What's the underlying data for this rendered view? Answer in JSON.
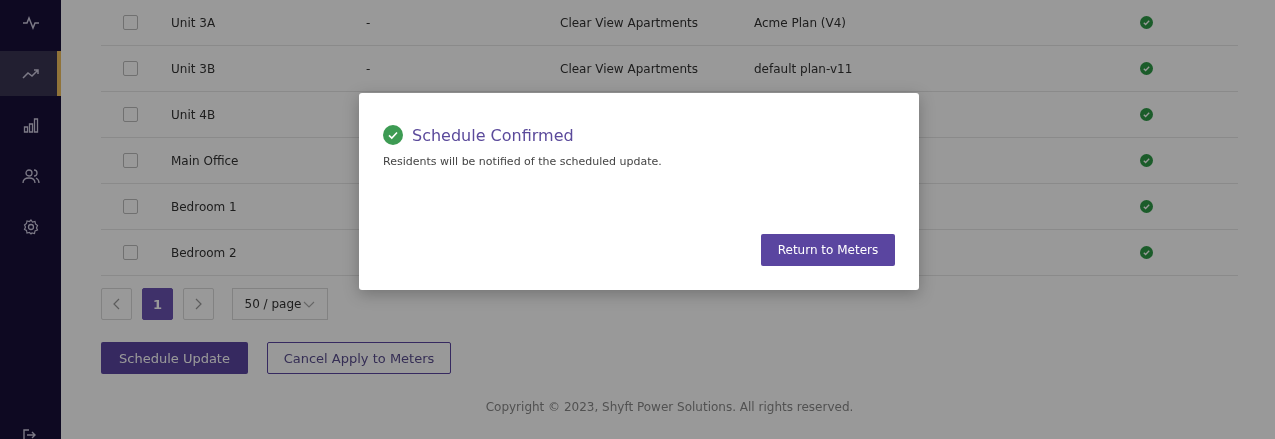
{
  "sidebar": {
    "items": [
      {
        "selected": false
      },
      {
        "selected": true
      },
      {
        "selected": false
      },
      {
        "selected": false
      },
      {
        "selected": false
      }
    ]
  },
  "table": {
    "rows": [
      {
        "checked": false,
        "name": "Unit 3A",
        "column_2": "-",
        "column_3": "Clear View Apartments",
        "column_4": "Acme Plan (V4)"
      },
      {
        "checked": false,
        "name": "Unit 3B",
        "column_2": "-",
        "column_3": "Clear View Apartments",
        "column_4": "default plan-v11"
      },
      {
        "checked": false,
        "name": "Unit 4B"
      },
      {
        "checked": false,
        "name": "Main Office"
      },
      {
        "checked": false,
        "name": "Bedroom 1"
      },
      {
        "checked": false,
        "name": "Bedroom 2"
      }
    ]
  },
  "pagination": {
    "pages": [
      {
        "label": "1",
        "selected": true
      }
    ],
    "page_size": "50 / page"
  },
  "actions": [
    "Schedule Update",
    "Cancel Apply to Meters"
  ],
  "footer": "Copyright © 2023, Shyft Power Solutions. All rights reserved.",
  "dialog": {
    "title": "Schedule Confirmed",
    "message": "Residents will be notified of the scheduled update.",
    "button": "Return to Meters"
  }
}
